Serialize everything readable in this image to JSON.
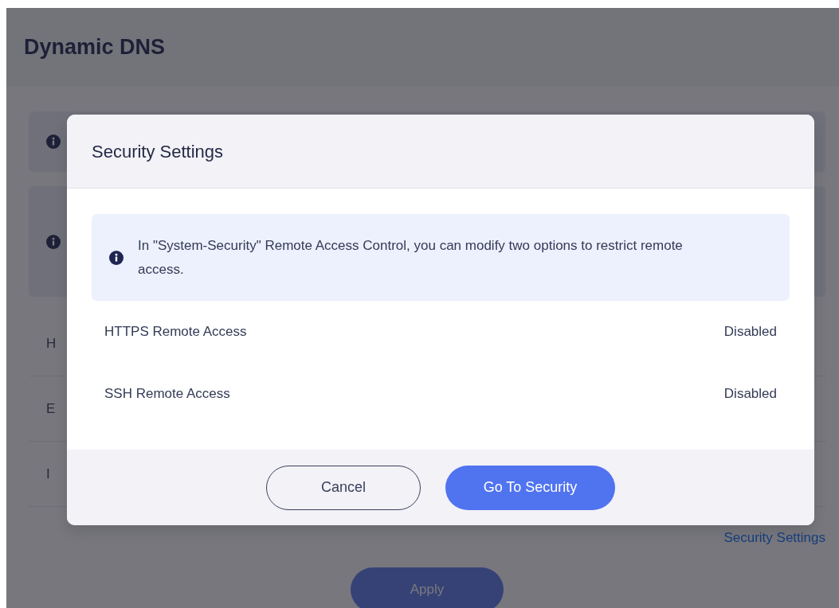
{
  "page": {
    "title": "Dynamic DNS",
    "rows": [
      {
        "label": "H"
      },
      {
        "label": "E"
      },
      {
        "label": "I"
      }
    ],
    "link": "Security Settings",
    "apply_button": "Apply"
  },
  "dialog": {
    "title": "Security Settings",
    "message": "In \"System-Security\" Remote Access Control, you can modify two options to restrict remote access.",
    "settings": [
      {
        "label": "HTTPS Remote Access",
        "value": "Disabled"
      },
      {
        "label": "SSH Remote Access",
        "value": "Disabled"
      }
    ],
    "buttons": [
      {
        "label": "Cancel",
        "kind": "secondary"
      },
      {
        "label": "Go To Security",
        "kind": "primary"
      }
    ]
  }
}
